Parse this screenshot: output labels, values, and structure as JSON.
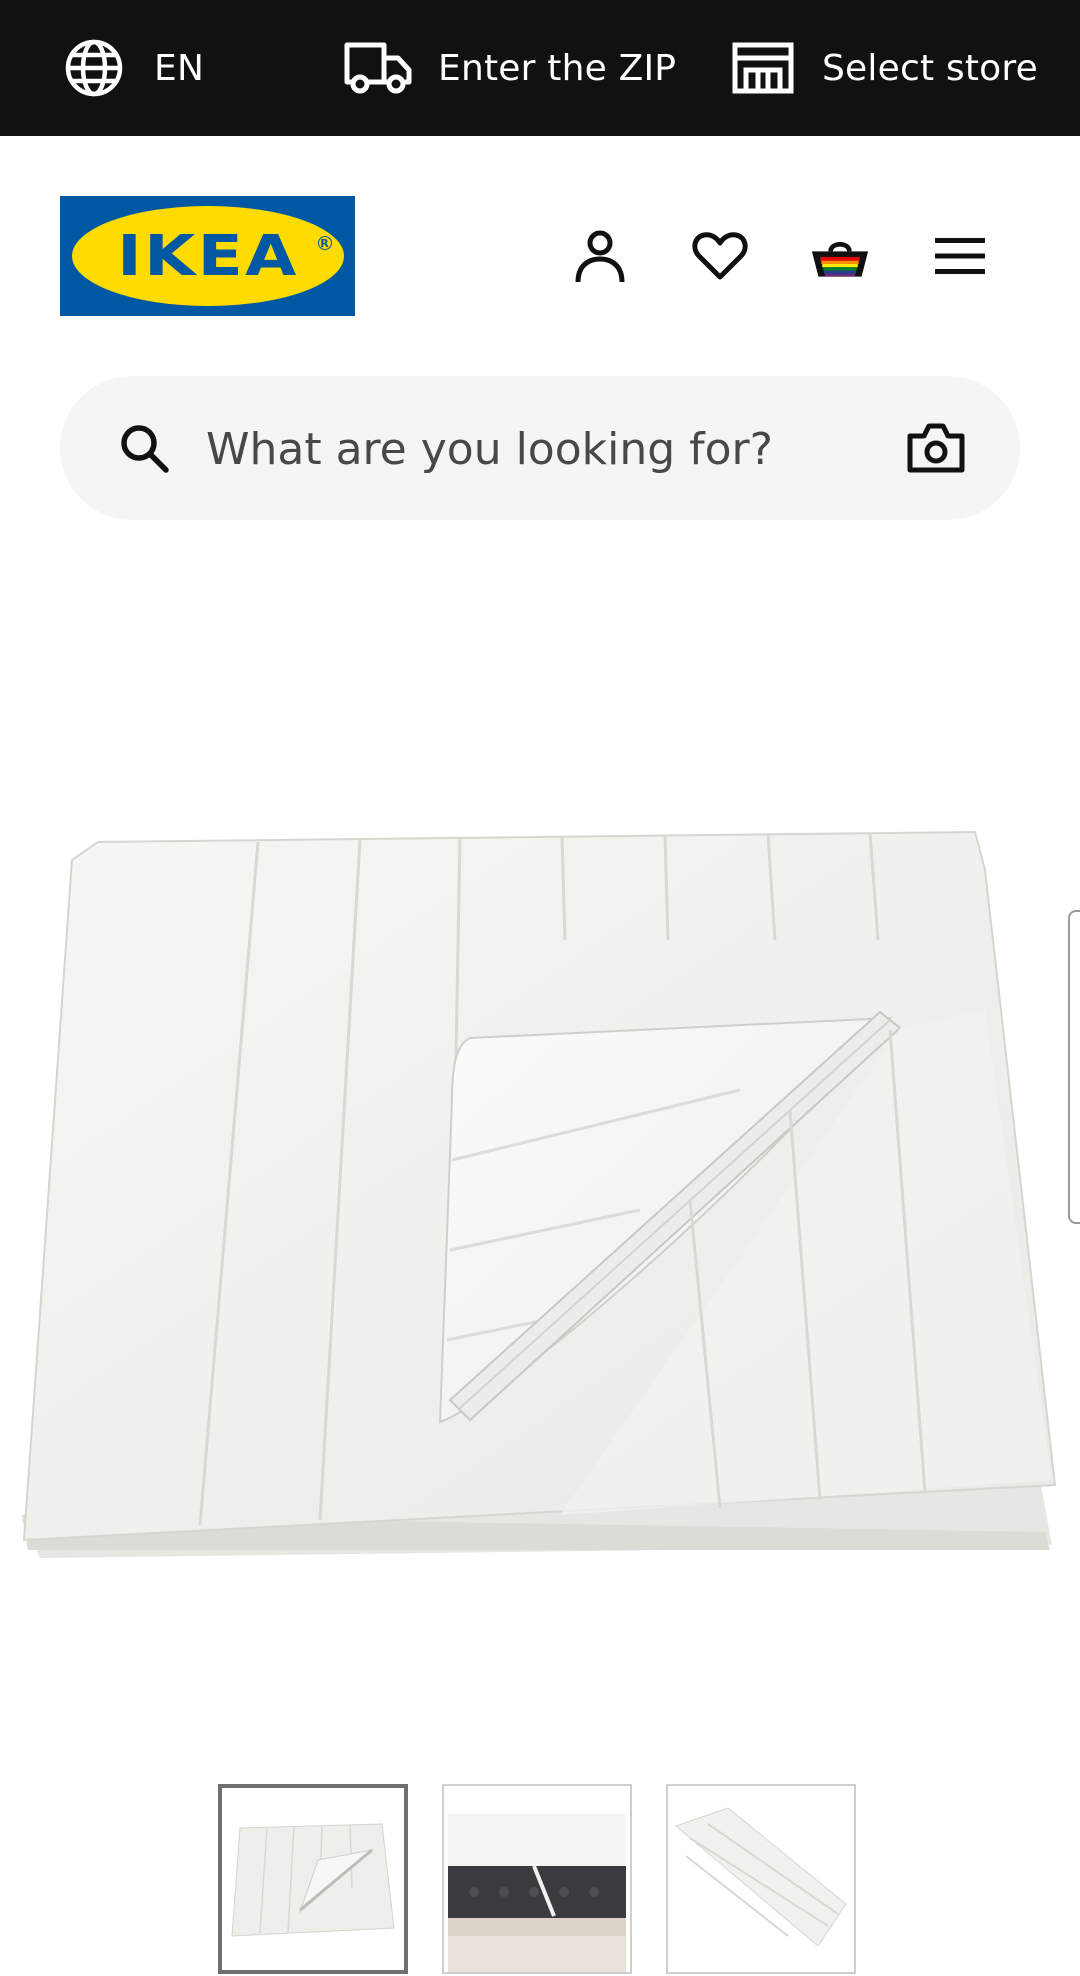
{
  "topbar": {
    "language": {
      "label": "EN",
      "icon": "globe-icon"
    },
    "delivery": {
      "label": "Enter the ZIP",
      "icon": "truck-icon"
    },
    "store": {
      "label": "Select store",
      "icon": "store-icon"
    }
  },
  "header": {
    "logo_text": "IKEA",
    "icons": [
      "user-icon",
      "heart-icon",
      "basket-icon",
      "menu-icon"
    ]
  },
  "search": {
    "placeholder": "What are you looking for?",
    "icon": "search-icon",
    "camera_icon": "camera-icon"
  },
  "product": {
    "image": "folded-white-quilted-mattress-protector"
  },
  "thumbnails": [
    {
      "image": "folded-mattress-protector",
      "selected": true
    },
    {
      "image": "mattress-protector-on-mattress",
      "selected": false
    },
    {
      "image": "mattress-protector-detail",
      "selected": false
    }
  ],
  "colors": {
    "topbar_bg": "#111111",
    "ikea_blue": "#0058A3",
    "ikea_yellow": "#FFDB00",
    "search_bg": "#F5F5F5"
  }
}
